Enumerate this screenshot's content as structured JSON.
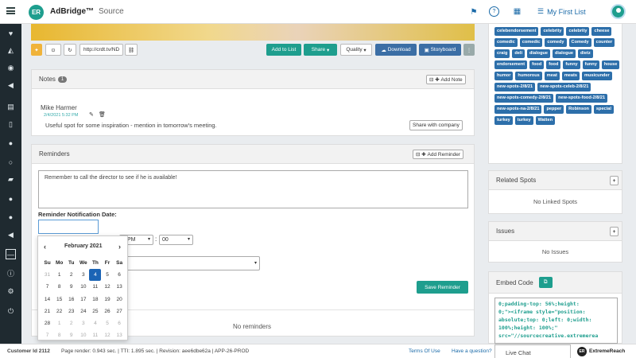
{
  "app": {
    "logo_text": "ER",
    "brand": "AdBridge™",
    "section": "Source",
    "my_list": "My First List"
  },
  "player": {
    "url": "http://crdt.tv/ND",
    "add_to_list": "Add to List",
    "share": "Share",
    "quality": "Quality",
    "download": "Download",
    "storyboard": "Storyboard"
  },
  "notes": {
    "title": "Notes",
    "count": "1",
    "add_label": "Add Note",
    "author": "Mike Harmer",
    "date": "2/4/2021 5:32 PM",
    "text": "Useful spot for some inspiration - mention in tomorrow's meeting.",
    "share_label": "Share with company"
  },
  "reminders": {
    "title": "Reminders",
    "add_label": "Add Reminder",
    "text": "Remember to call the director to see if he is available!",
    "date_label": "Reminder Notification Date:",
    "date_value": "",
    "ampm": "PM",
    "minutes": "00",
    "save_label": "Save Reminder",
    "empty": "No reminders"
  },
  "calendar": {
    "month": "February 2021",
    "prev": "‹",
    "next": "›",
    "dow": [
      "Su",
      "Mo",
      "Tu",
      "We",
      "Th",
      "Fr",
      "Sa"
    ],
    "weeks": [
      [
        "31",
        "1",
        "2",
        "3",
        "4",
        "5",
        "6"
      ],
      [
        "7",
        "8",
        "9",
        "10",
        "11",
        "12",
        "13"
      ],
      [
        "14",
        "15",
        "16",
        "17",
        "18",
        "19",
        "20"
      ],
      [
        "21",
        "22",
        "23",
        "24",
        "25",
        "26",
        "27"
      ],
      [
        "28",
        "1",
        "2",
        "3",
        "4",
        "5",
        "6"
      ],
      [
        "7",
        "8",
        "9",
        "10",
        "11",
        "12",
        "13"
      ]
    ],
    "selected": "4"
  },
  "tags": [
    "celebendorsement",
    "celebrity",
    "celebrity",
    "cheese",
    "comedic",
    "comedic",
    "comedy",
    "Comedy",
    "counter",
    "craig",
    "deli",
    "dialogue",
    "dialogue",
    "dietz",
    "endorsement",
    "food",
    "food",
    "funny",
    "funny",
    "house",
    "humor",
    "humorous",
    "meat",
    "meats",
    "musicunder",
    "new-spots-2/8/21",
    "new-spots-celeb-2/8/21",
    "new-spots-comedy-2/8/21",
    "new-spots-food-2/8/21",
    "new-spots-na-2/8/21",
    "pepper",
    "Robinson",
    "special",
    "turkey",
    "turkey",
    "Watten"
  ],
  "related": {
    "title": "Related Spots",
    "empty": "No Linked Spots"
  },
  "issues": {
    "title": "Issues",
    "empty": "No Issues"
  },
  "embed": {
    "title": "Embed Code",
    "lines": [
      "0;padding-top: 56%;height:",
      "0;\"><iframe style=\"position:",
      "absolute;top: 0;left: 0;width:",
      "100%;height: 100%;\"",
      "src=\"//sourcecreative.extremerea"
    ]
  },
  "footer": {
    "customer": "Customer Id 2112",
    "stats": "Page render: 0.943 sec. | TTI: 1.895 sec. | Revision: aee6dbe62a | APP-26-PROD",
    "terms": "Terms Of Use",
    "question": "Have a question?",
    "chat": "Live Chat",
    "er_logo": "ER",
    "er_brand": "ExtremeReach"
  }
}
